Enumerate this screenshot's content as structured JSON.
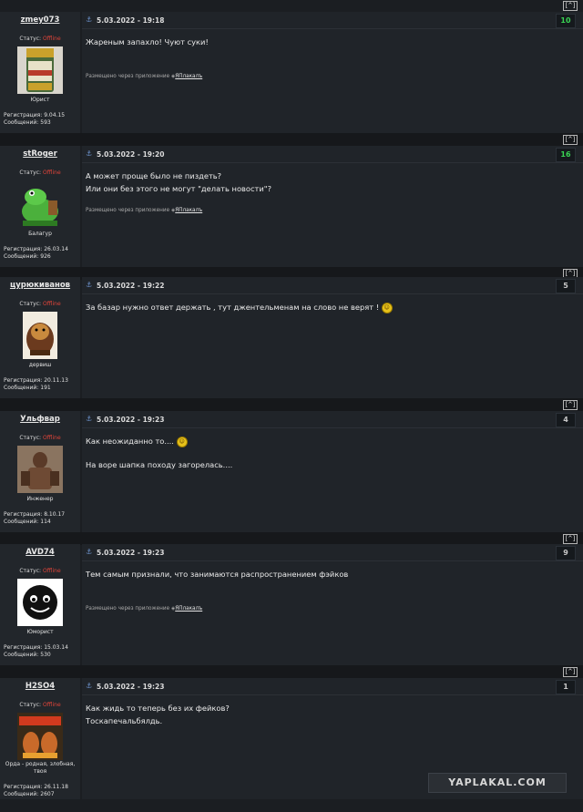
{
  "top_button_label": "[^]",
  "labels": {
    "status_prefix": "Статус:",
    "status_value": "Offline",
    "reg_prefix": "Регистрация:",
    "msgs_prefix": "Сообщений:",
    "via_prefix": "Размещено через приложение",
    "via_app": "ЯПлакалъ"
  },
  "colors": {
    "offline": "#e0443a",
    "rating_positive": "#39d353",
    "anchor": "#6b90c9"
  },
  "posts": [
    {
      "username": "zmey073",
      "rank": "Юрист",
      "reg": "9.04.15",
      "msgs": "593",
      "date": "5.03.2022 - 19:18",
      "rating": "10",
      "lines": [
        "Жареным запахло! Чуют суки!",
        ""
      ],
      "via_app": true
    },
    {
      "username": "stRoger",
      "rank": "Балагур",
      "reg": "26.03.14",
      "msgs": "926",
      "date": "5.03.2022 - 19:20",
      "rating": "16",
      "lines": [
        "А может проще было не пиздеть?",
        "Или они без этого не могут \"делать новости\"?"
      ],
      "via_app": true
    },
    {
      "username": "цурюкиванов",
      "rank": "дервиш",
      "reg": "20.11.13",
      "msgs": "191",
      "date": "5.03.2022 - 19:22",
      "rating": "5",
      "lines": [
        "За базар нужно ответ держать , тут джентельменам на слово не верят !",
        ""
      ],
      "via_app": false
    },
    {
      "username": "Ульфвар",
      "rank": "Инженер",
      "reg": "8.10.17",
      "msgs": "114",
      "date": "5.03.2022 - 19:23",
      "rating": "4",
      "lines": [
        "Как неожиданно то....",
        "На воре шапка походу загорелась...."
      ],
      "via_app": false
    },
    {
      "username": "AVD74",
      "rank": "Юморист",
      "reg": "15.03.14",
      "msgs": "530",
      "date": "5.03.2022 - 19:23",
      "rating": "9",
      "lines": [
        "Тем самым признали, что занимаются распространением фэйков",
        ""
      ],
      "via_app": true
    },
    {
      "username": "H2SO4",
      "rank": "Орда - родная, злобная, твоя",
      "reg": "26.11.18",
      "msgs": "2607",
      "date": "5.03.2022 - 19:23",
      "rating": "1",
      "lines": [
        "Как жидь то теперь без их фейков?",
        "Тоскапечальбялдь."
      ],
      "via_app": false
    }
  ],
  "watermark": "YAPLAKAL.COM"
}
